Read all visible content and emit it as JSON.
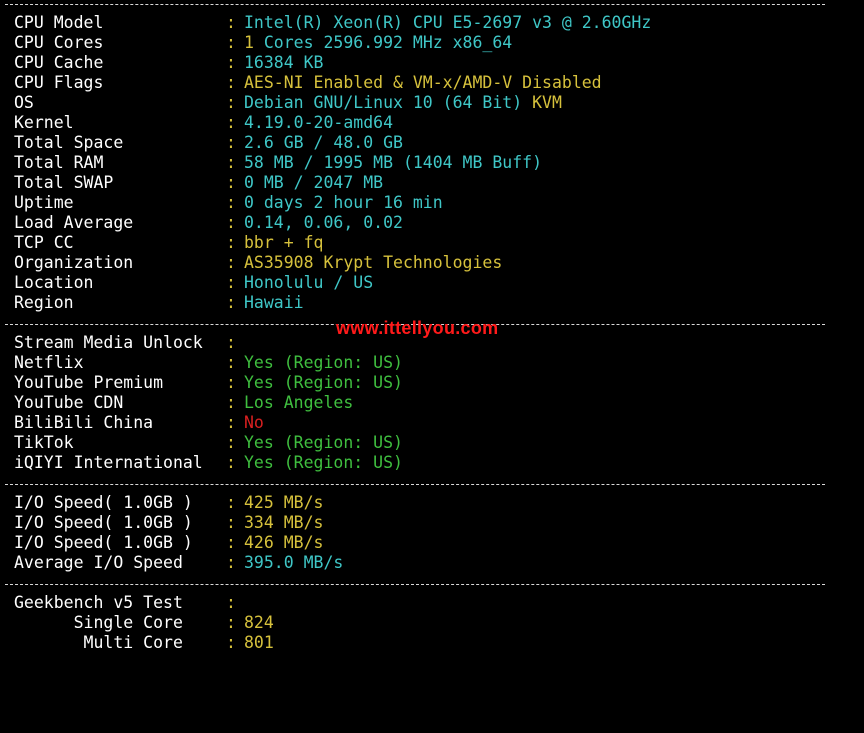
{
  "system": {
    "cpu_model": {
      "label": "CPU Model",
      "value": "Intel(R) Xeon(R) CPU E5-2697 v3 @ 2.60GHz"
    },
    "cpu_cores": {
      "label": "CPU Cores",
      "value": "1 Cores 2596.992 MHz x86_64"
    },
    "cpu_cache": {
      "label": "CPU Cache",
      "value": "16384 KB"
    },
    "cpu_flags": {
      "label": "CPU Flags",
      "value": "AES-NI Enabled & VM-x/AMD-V Disabled"
    },
    "os": {
      "label": "OS",
      "value": "Debian GNU/Linux 10 (64 Bit)",
      "virt": "KVM"
    },
    "kernel": {
      "label": "Kernel",
      "value": "4.19.0-20-amd64"
    },
    "total_space": {
      "label": "Total Space",
      "value": "2.6 GB / 48.0 GB"
    },
    "total_ram": {
      "label": "Total RAM",
      "value": "58 MB / 1995 MB (1404 MB Buff)"
    },
    "total_swap": {
      "label": "Total SWAP",
      "value": "0 MB / 2047 MB"
    },
    "uptime": {
      "label": "Uptime",
      "value": "0 days 2 hour 16 min"
    },
    "load_average": {
      "label": "Load Average",
      "value": "0.14, 0.06, 0.02"
    },
    "tcp_cc": {
      "label": "TCP CC",
      "value": "bbr + fq"
    },
    "organization": {
      "label": "Organization",
      "value": "AS35908 Krypt Technologies"
    },
    "location": {
      "label": "Location",
      "value": "Honolulu / US"
    },
    "region": {
      "label": "Region",
      "value": "Hawaii"
    }
  },
  "watermark": "www.ittellyou.com",
  "stream": {
    "header": {
      "label": "Stream Media Unlock",
      "value": ""
    },
    "netflix": {
      "label": "Netflix",
      "value": "Yes (Region: US)"
    },
    "youtube_premium": {
      "label": "YouTube Premium",
      "value": "Yes (Region: US)"
    },
    "youtube_cdn": {
      "label": "YouTube CDN",
      "value": "Los Angeles"
    },
    "bilibili": {
      "label": "BiliBili China",
      "value": "No"
    },
    "tiktok": {
      "label": "TikTok",
      "value": "Yes (Region: US)"
    },
    "iqiyi": {
      "label": "iQIYI International",
      "value": "Yes (Region: US)"
    }
  },
  "io": {
    "run1": {
      "label": "I/O Speed( 1.0GB )",
      "value": "425 MB/s"
    },
    "run2": {
      "label": "I/O Speed( 1.0GB )",
      "value": "334 MB/s"
    },
    "run3": {
      "label": "I/O Speed( 1.0GB )",
      "value": "426 MB/s"
    },
    "average": {
      "label": "Average I/O Speed",
      "value": "395.0 MB/s"
    }
  },
  "geekbench": {
    "header": {
      "label": "Geekbench v5 Test",
      "value": ""
    },
    "single": {
      "label": "      Single Core",
      "value": "824"
    },
    "multi": {
      "label": "       Multi Core",
      "value": "801"
    }
  },
  "colors": {
    "cyan": "#3fc7c7",
    "yellow": "#d6c13c",
    "green": "#3fbf3f",
    "red": "#d82020",
    "watermark": "#ff1a1a",
    "background": "#000000"
  },
  "colon": ":"
}
